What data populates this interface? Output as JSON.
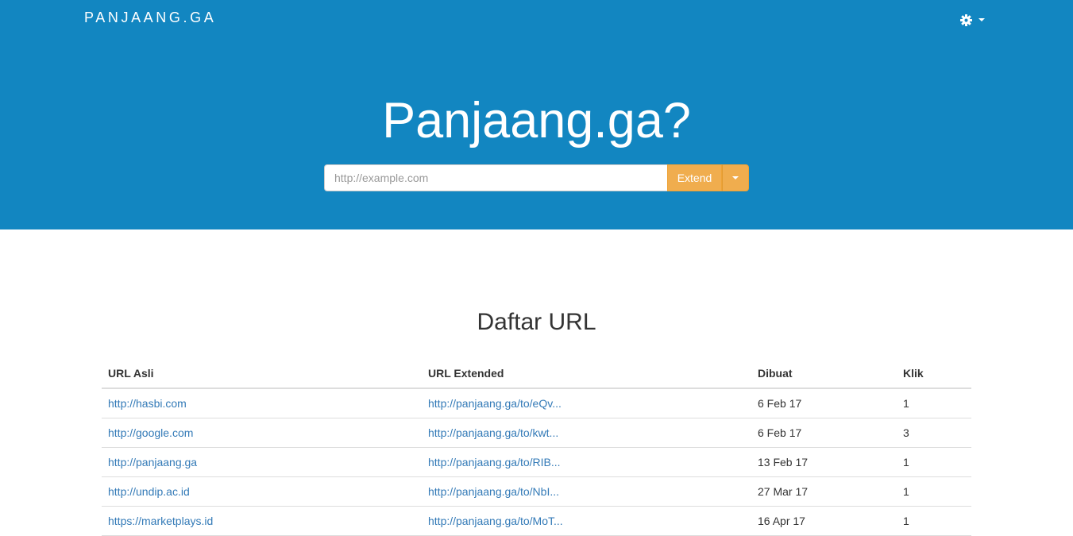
{
  "navbar": {
    "brand": "PANJAANG.GA",
    "settings_icon": "gear-icon",
    "settings_caret_icon": "caret-down-icon"
  },
  "hero": {
    "title": "Panjaang.ga?",
    "input_placeholder": "http://example.com",
    "input_value": "",
    "extend_button": "Extend",
    "dropdown_icon": "caret-down-icon"
  },
  "section": {
    "title": "Daftar URL"
  },
  "table": {
    "headers": {
      "original": "URL Asli",
      "extended": "URL Extended",
      "created": "Dibuat",
      "clicks": "Klik"
    },
    "rows": [
      {
        "original": "http://hasbi.com",
        "extended": "http://panjaang.ga/to/eQv...",
        "created": "6 Feb 17",
        "clicks": "1"
      },
      {
        "original": "http://google.com",
        "extended": "http://panjaang.ga/to/kwt...",
        "created": "6 Feb 17",
        "clicks": "3"
      },
      {
        "original": "http://panjaang.ga",
        "extended": "http://panjaang.ga/to/RIB...",
        "created": "13 Feb 17",
        "clicks": "1"
      },
      {
        "original": "http://undip.ac.id",
        "extended": "http://panjaang.ga/to/NbI...",
        "created": "27 Mar 17",
        "clicks": "1"
      },
      {
        "original": "https://marketplays.id",
        "extended": "http://panjaang.ga/to/MoT...",
        "created": "16 Apr 17",
        "clicks": "1"
      }
    ]
  },
  "colors": {
    "hero_background": "#1286c1",
    "accent_button": "#f0ad4e",
    "link": "#337ab7"
  }
}
